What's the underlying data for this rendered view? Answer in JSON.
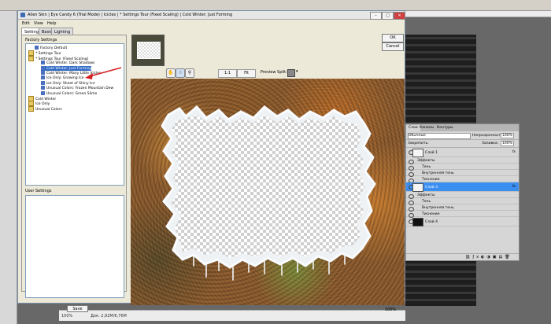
{
  "dialog": {
    "title": "Alien Skin | Eye Candy 6 (Trial Mode) | Icicles | * Settings Tour (Fixed Scaling) | Cold Winter: Just Forming",
    "menu": [
      "Edit",
      "View",
      "Help"
    ],
    "tabs": [
      "Settings",
      "Basic",
      "Lighting"
    ],
    "factory_settings_label": "Factory Settings",
    "tree": [
      {
        "label": "Factory Default",
        "type": "preset",
        "indent": 1
      },
      {
        "label": "* Settings Tour",
        "type": "folder",
        "indent": 0
      },
      {
        "label": "* Settings Tour (Fixed Scaling)",
        "type": "folder",
        "indent": 0
      },
      {
        "label": "Cold Winter: Dark Shadows",
        "type": "preset",
        "indent": 2
      },
      {
        "label": "Cold Winter: Just Forming",
        "type": "preset",
        "indent": 2,
        "selected": true
      },
      {
        "label": "Cold Winter: Many Little Icicles",
        "type": "preset",
        "indent": 2
      },
      {
        "label": "Ice Only: Growing Ice",
        "type": "preset",
        "indent": 2
      },
      {
        "label": "Ice Only: Sheet of Shiny Ice",
        "type": "preset",
        "indent": 2
      },
      {
        "label": "Unusual Colors: Frozen Mountain Dew",
        "type": "preset",
        "indent": 2
      },
      {
        "label": "Unusual Colors: Green Slime",
        "type": "preset",
        "indent": 2
      },
      {
        "label": "Cold Winter",
        "type": "folder",
        "indent": 0
      },
      {
        "label": "Ice Only",
        "type": "folder",
        "indent": 0
      },
      {
        "label": "Unusual Colors",
        "type": "folder",
        "indent": 0
      }
    ],
    "user_settings_label": "User Settings",
    "save_label": "Save",
    "ok_label": "OK",
    "cancel_label": "Cancel",
    "zoom_1to1": "1:1",
    "zoom_fit": "Fit",
    "preview_split_label": "Preview Split:",
    "zoom_percent": "100%",
    "window_buttons": [
      "–",
      "□",
      "✕"
    ]
  },
  "photoshop": {
    "status_zoom": "100%",
    "status_doc": "Док: 2,92M/6,76M"
  },
  "layers_panel": {
    "tabs": [
      "Слои",
      "Каналы",
      "Контуры"
    ],
    "blend_mode": "Обычные",
    "opacity_label": "Непрозрачность:",
    "opacity_value": "100%",
    "lock_label": "Закрепить:",
    "fill_label": "Заливка:",
    "fill_value": "100%",
    "rows": [
      {
        "label": "Слой 1",
        "kind": "layer",
        "fx": true
      },
      {
        "label": "Эффекты",
        "kind": "effects"
      },
      {
        "label": "Тень",
        "kind": "effect"
      },
      {
        "label": "Внутренняя тень",
        "kind": "effect"
      },
      {
        "label": "Тиснение",
        "kind": "effect"
      },
      {
        "label": "Слой 3",
        "kind": "layer",
        "fx": true,
        "selected": true
      },
      {
        "label": "Эффекты",
        "kind": "effects"
      },
      {
        "label": "Тень",
        "kind": "effect"
      },
      {
        "label": "Внутренняя тень",
        "kind": "effect"
      },
      {
        "label": "Тиснение",
        "kind": "effect"
      },
      {
        "label": "Слой 4",
        "kind": "layer"
      }
    ],
    "bottom_icons": [
      "link-icon",
      "fx-icon",
      "mask-icon",
      "adjustment-icon",
      "folder-icon",
      "new-layer-icon",
      "trash-icon"
    ]
  },
  "colors": {
    "selection": "#316ac5",
    "layer_selected": "#3b8ff0",
    "annotation_arrow": "#d62020"
  }
}
